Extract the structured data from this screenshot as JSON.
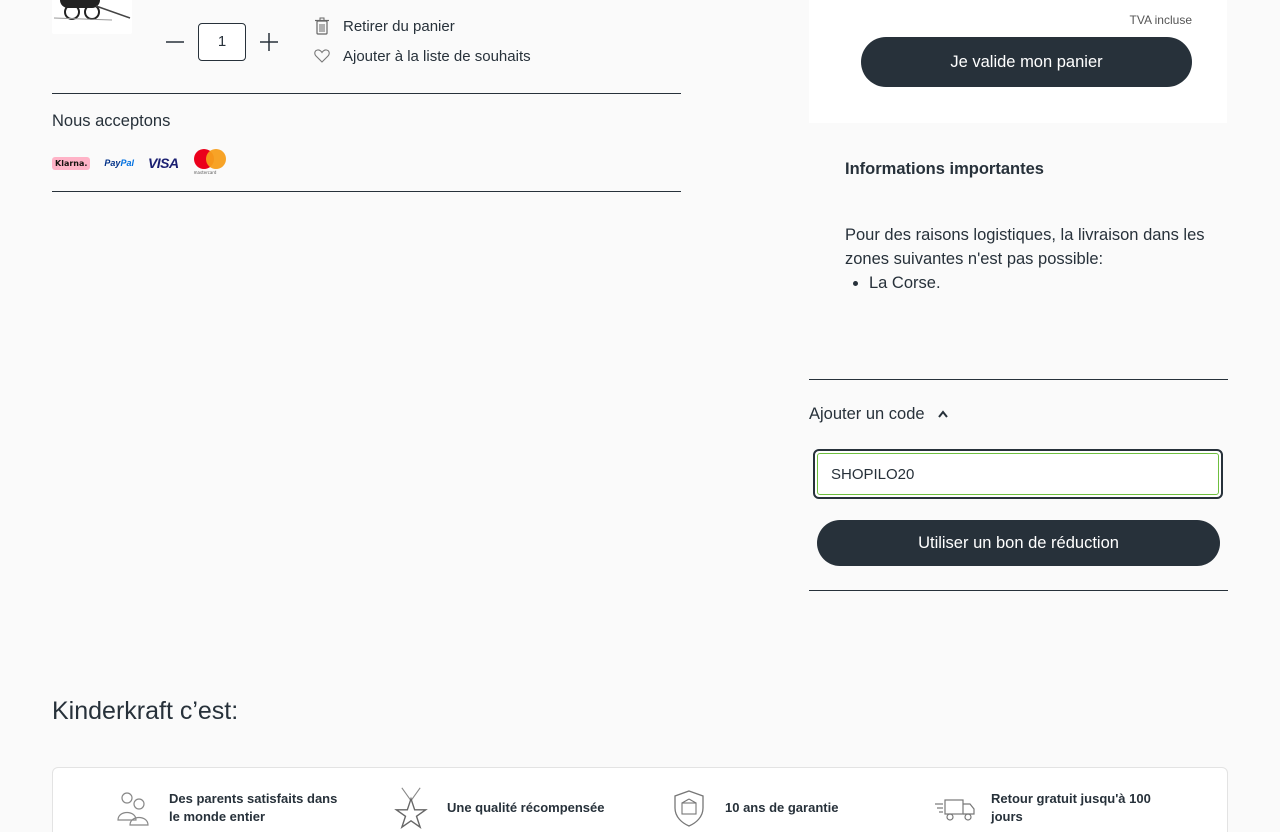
{
  "cart": {
    "quantity": "1",
    "remove_label": "Retirer du panier",
    "wishlist_label": "Ajouter à la liste de souhaits"
  },
  "payments": {
    "title": "Nous acceptons",
    "klarna": "Klarna.",
    "paypal_a": "Pay",
    "paypal_b": "Pal",
    "visa": "VISA",
    "mastercard": "mastercard"
  },
  "summary": {
    "tax_note": "TVA incluse",
    "validate_label": "Je valide mon panier"
  },
  "info": {
    "title": "Informations importantes",
    "text": "Pour des raisons logistiques, la livraison dans les zones suivantes n'est pas possible:",
    "zones": [
      "La Corse."
    ]
  },
  "coupon": {
    "toggle_label": "Ajouter un code",
    "code_value": "SHOPILO20",
    "apply_label": "Utiliser un bon de réduction"
  },
  "brand": {
    "title": "Kinderkraft c’est:",
    "features": [
      {
        "icon": "parents-icon",
        "label": "Des parents satisfaits dans le monde entier"
      },
      {
        "icon": "award-star-icon",
        "label": "Une qualité récompensée"
      },
      {
        "icon": "shield-warranty-icon",
        "label": "10 ans de garantie"
      },
      {
        "icon": "delivery-truck-icon",
        "label": "Retour gratuit jusqu'à 100 jours"
      }
    ]
  },
  "colors": {
    "primary": "#27313a",
    "background": "#fafafa",
    "input_focus": "#6fbf3f"
  }
}
